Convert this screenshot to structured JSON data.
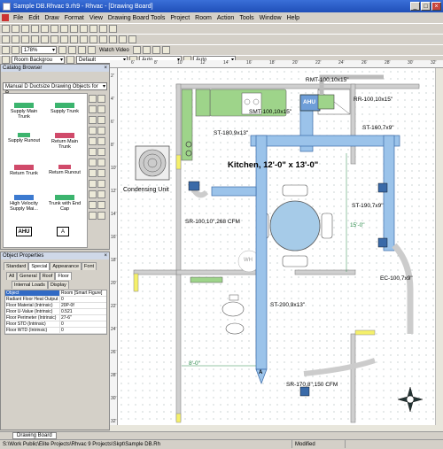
{
  "window": {
    "title": "Sample DB.Rhvac 9.rh9 - Rhvac - [Drawing Board]"
  },
  "menu": [
    "File",
    "Edit",
    "Draw",
    "Format",
    "View",
    "Drawing Board Tools",
    "Project",
    "Room",
    "Action",
    "Tools",
    "Window",
    "Help"
  ],
  "toolbar": {
    "zoom": "178%",
    "watch_video": "Watch Video",
    "layer_combo": "Room Backgrou",
    "line_combo": "Default",
    "auto1": "Auto",
    "auto2": "Auto"
  },
  "ruler_top": [
    "6'",
    "8'",
    "10'",
    "12'",
    "14'",
    "16'",
    "18'",
    "20'",
    "22'",
    "24'",
    "26'",
    "28'",
    "30'",
    "32'"
  ],
  "ruler_left": [
    "2'",
    "4'",
    "6'",
    "8'",
    "10'",
    "12'",
    "14'",
    "16'",
    "18'",
    "20'",
    "22'",
    "24'",
    "26'",
    "28'",
    "30'",
    "32'"
  ],
  "catalog": {
    "title": "Catalog Browser",
    "selector": "Manual D Ductsize Drawing Objects for R...",
    "items": [
      "Supply Main Trunk",
      "Supply Trunk",
      "Supply Runout",
      "Return Main Trunk",
      "Return Trunk",
      "Return Runout",
      "High Velocity Supply Mai...",
      "Trunk with End Cap"
    ],
    "ahu_label": "AHU",
    "a_label": "A"
  },
  "props": {
    "title": "Object Properties",
    "tabs1": [
      "Standard",
      "Special",
      "Appearance",
      "Font"
    ],
    "tabs2": [
      "All",
      "General",
      "Roof",
      "Floor"
    ],
    "tabs3": [
      "Internal Loads",
      "Display"
    ],
    "rows": [
      {
        "name": "Object",
        "value": "Room [Smart Figure]"
      },
      {
        "name": "Radiant Floor Heat Output",
        "value": "0"
      },
      {
        "name": "Floor Material (Intrinsic)",
        "value": "20P-0f"
      },
      {
        "name": "Floor U-Value (Intrinsic)",
        "value": "0.521"
      },
      {
        "name": "Floor Perimeter (Intrinsic)",
        "value": "27-6\""
      },
      {
        "name": "Floor STD (Intrinsic)",
        "value": "0"
      },
      {
        "name": "Floor WTD (Intrinsic)",
        "value": "0"
      }
    ]
  },
  "drawing": {
    "kitchen_label": "Kitchen, 12'-0\" x 13'-0\"",
    "condensing_unit": "Condensing Unit",
    "labels": {
      "rmt": "RMT-100,10x15\"",
      "smt": "SMT-100,10x15\"",
      "rr": "RR-100,10x15\"",
      "st180": "ST-180,9x13\"",
      "st160": "ST-160,7x9\"",
      "st190": "ST-190,7x9\"",
      "sr100": "SR-100,10\",268 CFM",
      "ec100": "EC-100,7x9\"",
      "st200": "ST-200,9x13\"",
      "sr170": "SR-170,8\",150 CFM",
      "dim15": "15'-0\"",
      "dim8": "8'-0\"",
      "ahu": "AHU",
      "a": "A",
      "wh": "WH"
    }
  },
  "doctab": "Drawing Board",
  "status": {
    "path": "S:\\Work Public\\Elite Projects\\Rhvac 9 Projects\\Skpt\\Sample DB.Rh",
    "modified": "Modified"
  }
}
